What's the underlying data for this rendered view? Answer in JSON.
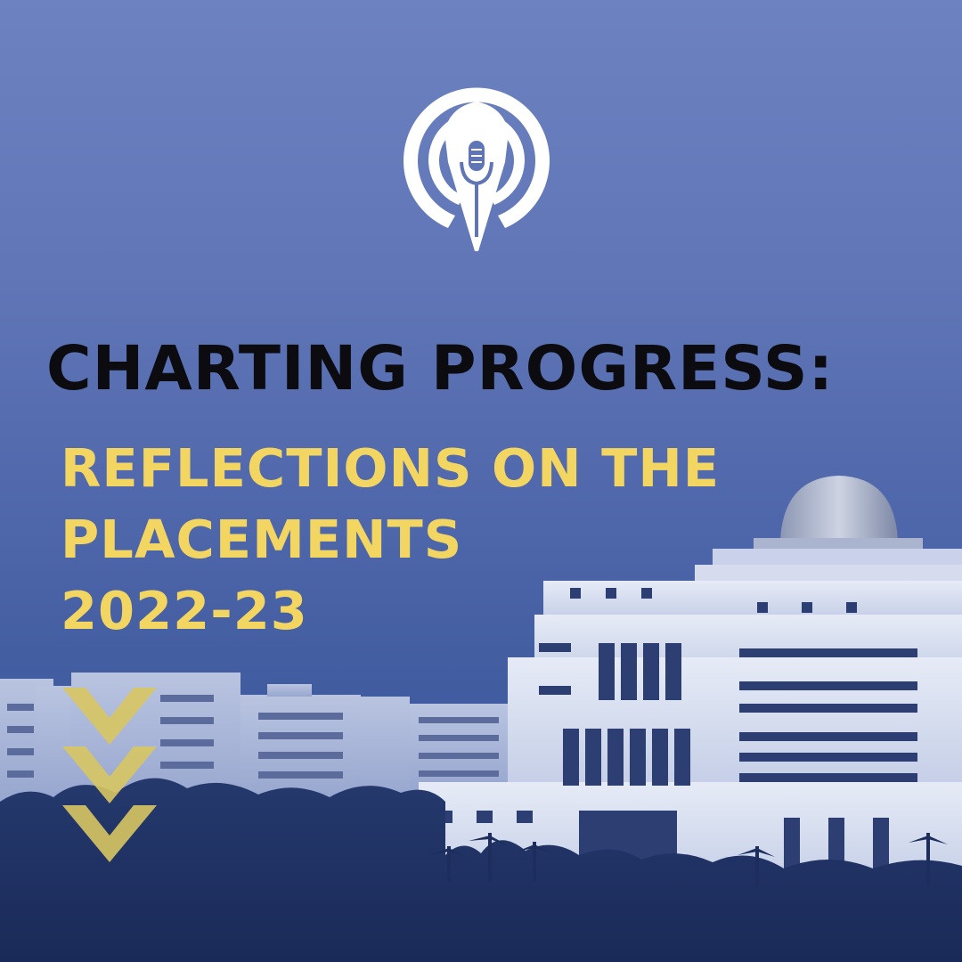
{
  "headline": "CHARTING PROGRESS:",
  "subheadline": {
    "line1": "REFLECTIONS ON THE",
    "line2": "PLACEMENTS",
    "line3": "2022-23"
  },
  "colors": {
    "background_top": "#6d82c0",
    "background_bottom": "#2f4a8a",
    "headline": "#0b0b10",
    "subheadline": "#f3d661",
    "chevron": "#d8c663",
    "logo": "#ffffff"
  },
  "icons": {
    "logo": "pen-nib-microphone-logo",
    "chevrons": "chevron-down-icon"
  }
}
